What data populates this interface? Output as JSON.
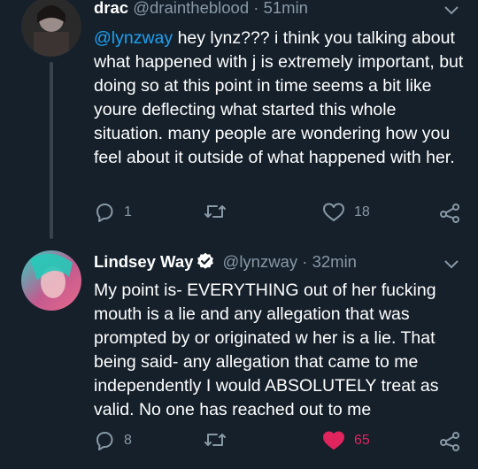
{
  "tweets": [
    {
      "name": "drac",
      "handle": "@draintheblood",
      "separator": "·",
      "time": "51min",
      "mention": "@lynzway",
      "text": " hey lynz??? i think you talking about what happened with j is extremely important, but doing so at this point in time seems a bit like youre deflecting what started this whole situation. many people are wondering how you feel about it outside of what happened with her.",
      "reply_count": "1",
      "retweet_count": "",
      "like_count": "18",
      "liked": false
    },
    {
      "name": "Lindsey Way",
      "verified": true,
      "handle": "@lynzway",
      "separator": "·",
      "time": "32min",
      "text": "My point is- EVERYTHING out of her fucking mouth is a lie and any allegation that was prompted by or originated w her is a lie. That being said- any allegation that came to me independently I would ABSOLUTELY treat as valid. No one has reached out to me",
      "reply_count": "8",
      "retweet_count": "",
      "like_count": "65",
      "liked": true
    }
  ],
  "colors": {
    "background": "#15202b",
    "mention": "#1da1f2",
    "secondary_text": "#8899a6",
    "like_active": "#e0245e",
    "verified": "#ffffff"
  },
  "icons": [
    "chevron-down-icon",
    "reply-icon",
    "retweet-icon",
    "heart-icon",
    "share-icon",
    "verified-badge-icon"
  ]
}
